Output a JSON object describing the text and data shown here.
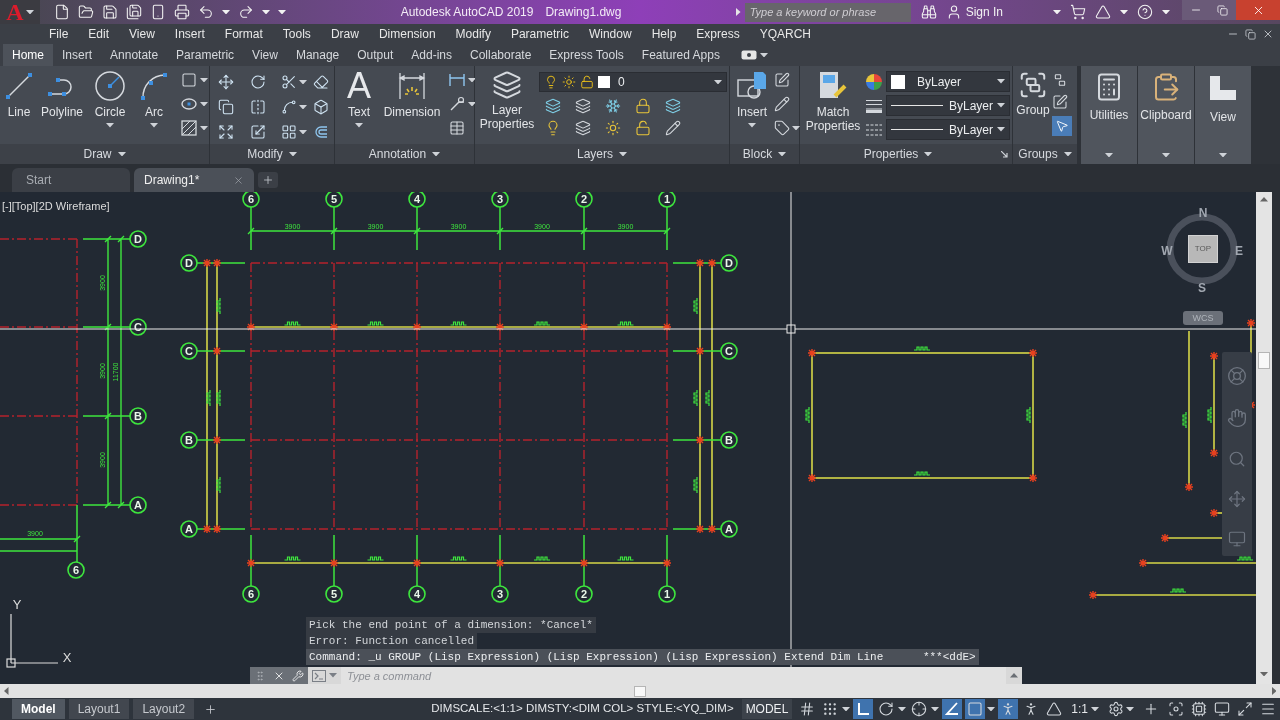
{
  "title_bar": {
    "logo": "A",
    "app": "Autodesk AutoCAD 2019",
    "document": "Drawing1.dwg",
    "search_placeholder": "Type a keyword or phrase",
    "sign_in": "Sign In"
  },
  "menu_bar": [
    "File",
    "Edit",
    "View",
    "Insert",
    "Format",
    "Tools",
    "Draw",
    "Dimension",
    "Modify",
    "Parametric",
    "Window",
    "Help",
    "Express",
    "YQARCH"
  ],
  "ribbon_tabs": [
    {
      "label": "Home",
      "selected": true
    },
    {
      "label": "Insert",
      "selected": false
    },
    {
      "label": "Annotate",
      "selected": false
    },
    {
      "label": "Parametric",
      "selected": false
    },
    {
      "label": "View",
      "selected": false
    },
    {
      "label": "Manage",
      "selected": false
    },
    {
      "label": "Output",
      "selected": false
    },
    {
      "label": "Add-ins",
      "selected": false
    },
    {
      "label": "Collaborate",
      "selected": false
    },
    {
      "label": "Express Tools",
      "selected": false
    },
    {
      "label": "Featured Apps",
      "selected": false
    }
  ],
  "ribbon": {
    "draw": {
      "title": "Draw",
      "tools": [
        {
          "kind": "line",
          "label": "Line",
          "dropdown": false
        },
        {
          "kind": "polyline",
          "label": "Polyline",
          "dropdown": false
        },
        {
          "kind": "circle",
          "label": "Circle",
          "dropdown": true
        },
        {
          "kind": "arc",
          "label": "Arc",
          "dropdown": true
        }
      ]
    },
    "modify": {
      "title": "Modify"
    },
    "annotation": {
      "title": "Annotation",
      "text_glyph": "A",
      "text_tool": "Text",
      "dimension_tool": "Dimension"
    },
    "layers": {
      "title": "Layers",
      "tool": "Layer Properties",
      "current_layer": "0"
    },
    "block": {
      "title": "Block",
      "tool": "Insert"
    },
    "properties": {
      "title": "Properties",
      "tool": "Match Properties",
      "combos": [
        {
          "kind": "color",
          "value": "ByLayer"
        },
        {
          "kind": "lineweight",
          "value": "ByLayer"
        },
        {
          "kind": "linetype",
          "value": "ByLayer"
        }
      ]
    },
    "groups": {
      "title": "Groups",
      "tool": "Group"
    },
    "collapsed_panels": [
      {
        "kind": "utilities",
        "label": "Utilities"
      },
      {
        "kind": "clipboard",
        "label": "Clipboard"
      },
      {
        "kind": "view",
        "label": "View"
      }
    ]
  },
  "file_tabs": [
    {
      "label": "Start",
      "selected": false
    },
    {
      "label": "Drawing1*",
      "selected": true
    }
  ],
  "viewport": {
    "label": "[-][Top][2D Wireframe]"
  },
  "plan": {
    "top_axes": [
      "6",
      "5",
      "4",
      "3",
      "2",
      "1"
    ],
    "bottom_axes": [
      "6",
      "5",
      "4",
      "3",
      "2",
      "1"
    ],
    "left_axes": [
      "D",
      "C",
      "B",
      "A"
    ],
    "right_axes": [
      "D",
      "C",
      "B",
      "A"
    ],
    "spacings": [
      "3900",
      "3900",
      "3900",
      "3900",
      "3900"
    ]
  },
  "side_plan": {
    "axes": [
      "D",
      "C",
      "B",
      "A"
    ],
    "spacings": [
      "3900",
      "3900",
      "3900"
    ],
    "total": "11700",
    "bottom_spacing": "3900",
    "bottom_axis": "6"
  },
  "viewcube": {
    "face": "TOP",
    "north": "N",
    "east": "E",
    "south": "S",
    "west": "W",
    "ucs": "WCS"
  },
  "ucs_icon": {
    "y": "Y",
    "x": "X"
  },
  "command_line": {
    "history": [
      "Pick the end point of a dimension: *Cancel*",
      "Error: Function cancelled",
      "Command: _u GROUP (Lisp Expression) (Lisp Expression) (Lisp Expression) Extend Dim Line      ***<ddE>"
    ],
    "placeholder": "Type a command"
  },
  "status_bar": {
    "layouts": [
      {
        "label": "Model",
        "selected": true
      },
      {
        "label": "Layout1",
        "selected": false
      },
      {
        "label": "Layout2",
        "selected": false
      }
    ],
    "info": "DIMSCALE:<1:1> DIMSTY:<DIM COL> STYLE:<YQ_DIM>",
    "space": "MODEL",
    "toggles": [
      {
        "kind": "grid",
        "on": false
      },
      {
        "kind": "snap",
        "on": false
      },
      {
        "kind": "ortho",
        "on": true
      },
      {
        "kind": "polar",
        "on": false
      },
      {
        "kind": "otrack",
        "on": false
      },
      {
        "kind": "isodraft",
        "on": true
      },
      {
        "kind": "osnap",
        "on": true
      },
      {
        "kind": "annovis",
        "on": true
      },
      {
        "kind": "autoscale",
        "on": false
      },
      {
        "kind": "annoscale",
        "on": false
      }
    ],
    "scale": "1:1"
  }
}
